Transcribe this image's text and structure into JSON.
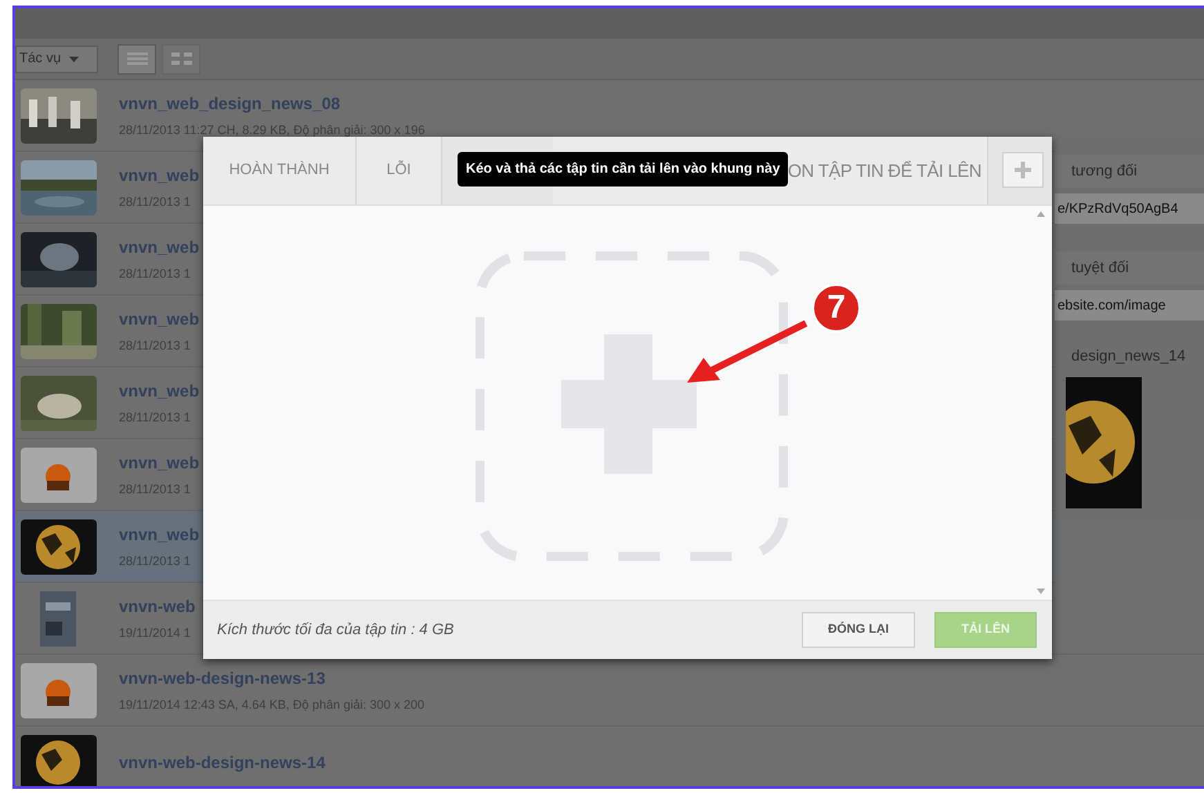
{
  "toolbar": {
    "actions_menu": "Tác vụ",
    "views": [
      {
        "kind": "list",
        "selected": true
      },
      {
        "kind": "grid",
        "selected": false
      }
    ]
  },
  "files": [
    {
      "name": "vnvn_web_design_news_08",
      "meta": "28/11/2013 11:27 CH, 8.29 KB, Độ phân giải: 300 x 196",
      "selected": false
    },
    {
      "name": "vnvn_web",
      "meta": "28/11/2013 1",
      "selected": false
    },
    {
      "name": "vnvn_web",
      "meta": "28/11/2013 1",
      "selected": false
    },
    {
      "name": "vnvn_web",
      "meta": "28/11/2013 1",
      "selected": false
    },
    {
      "name": "vnvn_web",
      "meta": "28/11/2013 1",
      "selected": false
    },
    {
      "name": "vnvn_web",
      "meta": "28/11/2013 1",
      "selected": false
    },
    {
      "name": "vnvn_web",
      "meta": "28/11/2013 1",
      "selected": true
    },
    {
      "name": "vnvn-web",
      "meta": "19/11/2014 1",
      "selected": false
    },
    {
      "name": "vnvn-web-design-news-13",
      "meta": "19/11/2014 12:43 SA, 4.64 KB, Độ phân giải: 300 x 200",
      "selected": false
    },
    {
      "name": "vnvn-web-design-news-14",
      "selected": false
    }
  ],
  "details": {
    "relative_label": "tương đối",
    "relative_value": "e/KPzRdVq50AgB4",
    "absolute_label": "tuyệt đối",
    "absolute_value": "ebsite.com/image",
    "file_name": "design_news_14"
  },
  "dialog": {
    "tabs": [
      {
        "label": "HOÀN THÀNH",
        "selected": false
      },
      {
        "label": "LỖI",
        "selected": false
      },
      {
        "label": "ON TẬP TIN ĐỂ TẢI LÊN",
        "selected": false
      }
    ],
    "tooltip": "Kéo và thả các tập tin cần tải lên vào khung này",
    "note": "Kích thước tối đa của tập tin : 4 GB",
    "buttons": [
      {
        "label": "ĐÓNG LẠI",
        "kind": "secondary",
        "disabled": false
      },
      {
        "label": "TẢI LÊN",
        "kind": "primary",
        "disabled": true
      }
    ]
  },
  "callout": "7"
}
